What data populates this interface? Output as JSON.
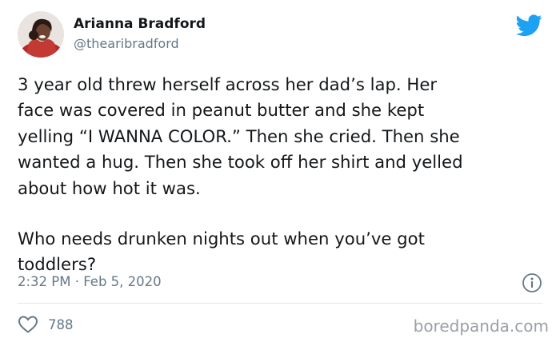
{
  "author": {
    "name": "Arianna Bradford",
    "handle": "@thearibradford"
  },
  "icons": {
    "avatar": "avatar-photo",
    "brand": "twitter-bird-icon",
    "info": "info-icon",
    "like": "heart-icon"
  },
  "colors": {
    "twitter_blue": "#1da1f2",
    "secondary_text": "#657786",
    "divider": "#e1e8ed"
  },
  "tweet": {
    "paragraphs": [
      "3 year old threw herself across her dad’s lap. Her\nface was covered in peanut butter and she kept\nyelling “I WANNA COLOR.” Then she cried. Then she\nwanted a hug. Then she took off her shirt and yelled\nabout how hot it was.",
      "Who needs drunken nights out when you’ve got\ntoddlers?"
    ],
    "timestamp": "2:32 PM · Feb 5, 2020",
    "like_count": "788"
  },
  "watermark": "boredpanda.com"
}
